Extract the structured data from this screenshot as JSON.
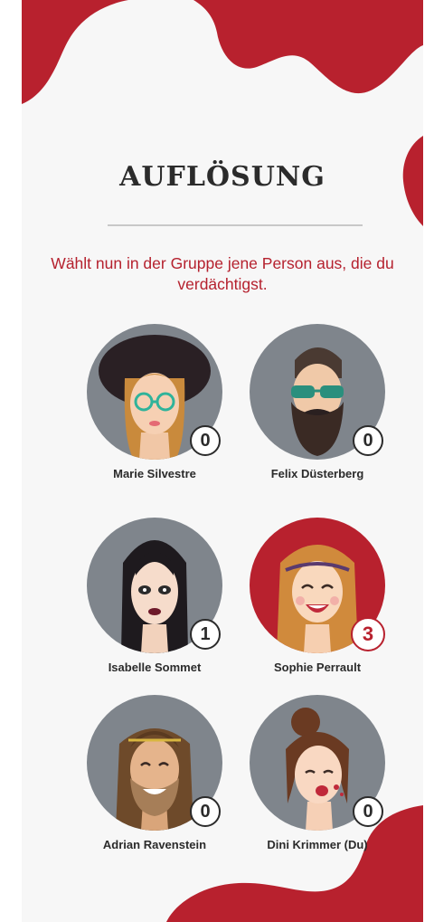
{
  "header": {
    "title": "AUFLÖSUNG",
    "instruction": "Wählt nun in der Gruppe jene Person aus, die du verdächtigst."
  },
  "colors": {
    "accent": "#b8212e",
    "avatar_bg": "#7f858c",
    "background": "#f7f7f7",
    "text": "#2b2b2b"
  },
  "players": [
    {
      "name": "Marie Silvestre",
      "votes": "0",
      "selected": false
    },
    {
      "name": "Felix Düsterberg",
      "votes": "0",
      "selected": false
    },
    {
      "name": "Isabelle Sommet",
      "votes": "1",
      "selected": false
    },
    {
      "name": "Sophie Perrault",
      "votes": "3",
      "selected": true
    },
    {
      "name": "Adrian Ravenstein",
      "votes": "0",
      "selected": false
    },
    {
      "name": "Dini Krimmer (Du)",
      "votes": "0",
      "selected": false
    }
  ]
}
